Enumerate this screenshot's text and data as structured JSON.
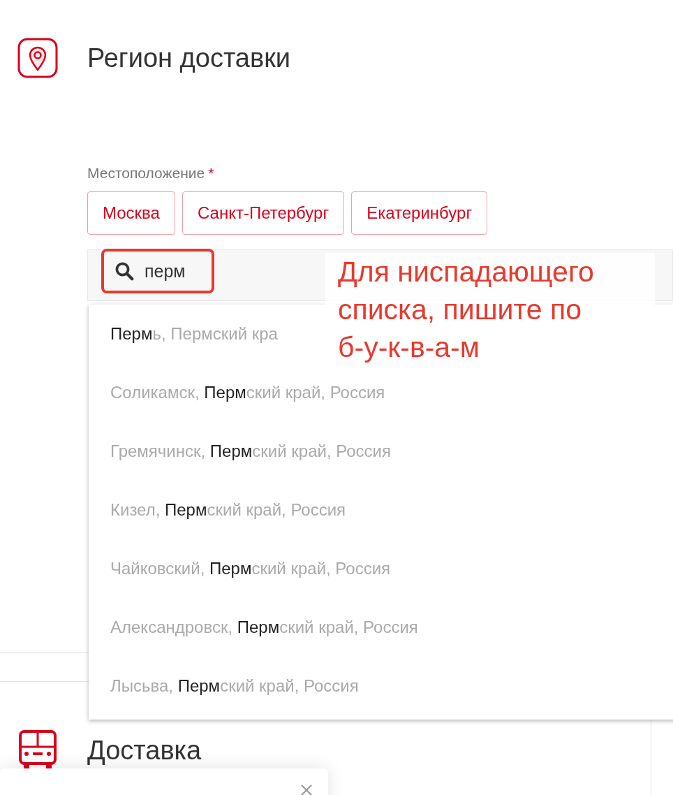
{
  "region_section": {
    "title": "Регион доставки"
  },
  "location_field": {
    "label": "Местоположение",
    "required_mark": "*"
  },
  "city_chips": [
    {
      "label": "Москва"
    },
    {
      "label": "Санкт-Петербург"
    },
    {
      "label": "Екатеринбург"
    }
  ],
  "search": {
    "value": "перм"
  },
  "dropdown_options": [
    {
      "match": "Перм",
      "suffix": "ь, Пермский кра"
    },
    {
      "prefix": "Соликамск, ",
      "match": "Перм",
      "suffix": "ский край, Россия"
    },
    {
      "prefix": "Гремячинск, ",
      "match": "Перм",
      "suffix": "ский край, Россия"
    },
    {
      "prefix": "Кизел, ",
      "match": "Перм",
      "suffix": "ский край, Россия"
    },
    {
      "prefix": "Чайковский, ",
      "match": "Перм",
      "suffix": "ский край, Россия"
    },
    {
      "prefix": "Александровск, ",
      "match": "Перм",
      "suffix": "ский край, Россия"
    },
    {
      "prefix": "Лысьва, ",
      "match": "Перм",
      "suffix": "ский край, Россия"
    }
  ],
  "annotation": {
    "text": "Для ниспадающего списка, пишите по б-у-к-в-а-м"
  },
  "delivery_section": {
    "title": "Доставка"
  }
}
